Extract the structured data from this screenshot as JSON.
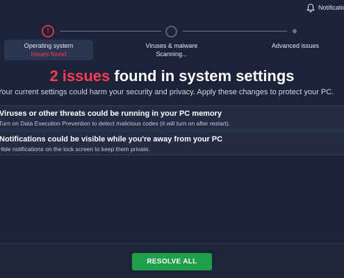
{
  "header": {
    "notifications_label": "Notifications",
    "notifications_icon": "bell-icon"
  },
  "colors": {
    "background": "#1b2338",
    "accent_red": "#ff3b55",
    "resolve_green": "#1f9f4a"
  },
  "steps": [
    {
      "title": "Operating system",
      "status": "Issues found",
      "icon": "exclamation-icon",
      "active": true
    },
    {
      "title": "Viruses & malware",
      "status": "Scanning..."
    },
    {
      "title": "Advanced issues",
      "status": ""
    }
  ],
  "main": {
    "headline_count": "2 issues",
    "headline_rest": " found in system settings",
    "subtitle": "Your current settings could harm your security and privacy. Apply these changes to protect your PC."
  },
  "issues": [
    {
      "title": "Viruses or other threats could be running in your PC memory",
      "description": "Turn on Data Execution Prevention to detect malicious codes (it will turn on after restart)."
    },
    {
      "title": "Notifications could be visible while you're away from your PC",
      "description": "Hide notifications on the lock screen to keep them private."
    }
  ],
  "footer": {
    "resolve_label": "RESOLVE ALL"
  }
}
